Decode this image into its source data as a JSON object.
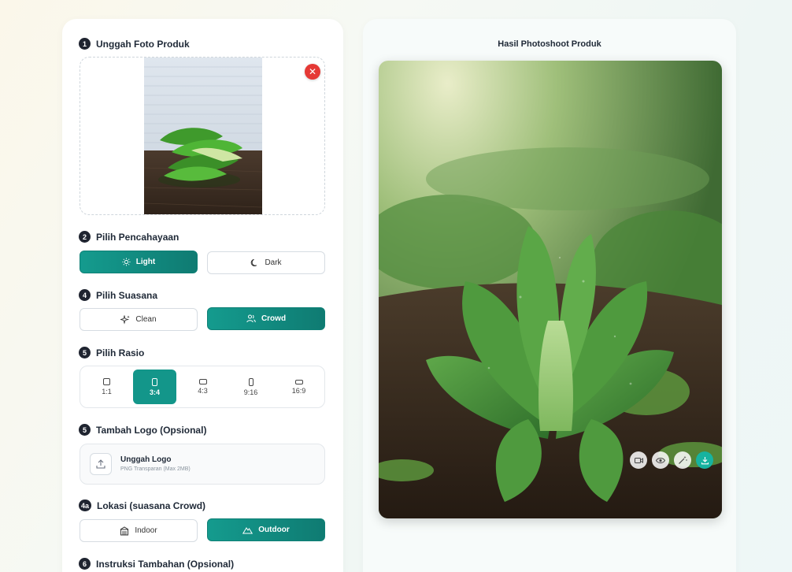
{
  "upload": {
    "step": "1",
    "title": "Unggah Foto Produk"
  },
  "lighting": {
    "step": "2",
    "title": "Pilih Pencahayaan",
    "options": [
      {
        "label": "Light",
        "active": true
      },
      {
        "label": "Dark",
        "active": false
      }
    ]
  },
  "mood": {
    "step": "4",
    "title": "Pilih Suasana",
    "options": [
      {
        "label": "Clean",
        "active": false
      },
      {
        "label": "Crowd",
        "active": true
      }
    ]
  },
  "ratio": {
    "step": "5",
    "title": "Pilih Rasio",
    "options": [
      {
        "label": "1:1",
        "active": false
      },
      {
        "label": "3:4",
        "active": true
      },
      {
        "label": "4:3",
        "active": false
      },
      {
        "label": "9:16",
        "active": false
      },
      {
        "label": "16:9",
        "active": false
      }
    ]
  },
  "logo": {
    "step": "5",
    "title": "Tambah Logo (Opsional)",
    "upload_label": "Unggah Logo",
    "upload_hint": "PNG Transparan (Max 2MB)"
  },
  "location": {
    "step": "4a",
    "title": "Lokasi (suasana Crowd)",
    "options": [
      {
        "label": "Indoor",
        "active": false
      },
      {
        "label": "Outdoor",
        "active": true
      }
    ]
  },
  "instructions": {
    "step": "6",
    "title": "Instruksi Tambahan (Opsional)"
  },
  "result": {
    "title": "Hasil Photoshoot Produk",
    "actions": [
      "video-icon",
      "eye-icon",
      "magic-wand-icon",
      "download-icon"
    ]
  },
  "colors": {
    "accent": "#13968a",
    "remove": "#e53935",
    "download": "#17b3a0"
  }
}
